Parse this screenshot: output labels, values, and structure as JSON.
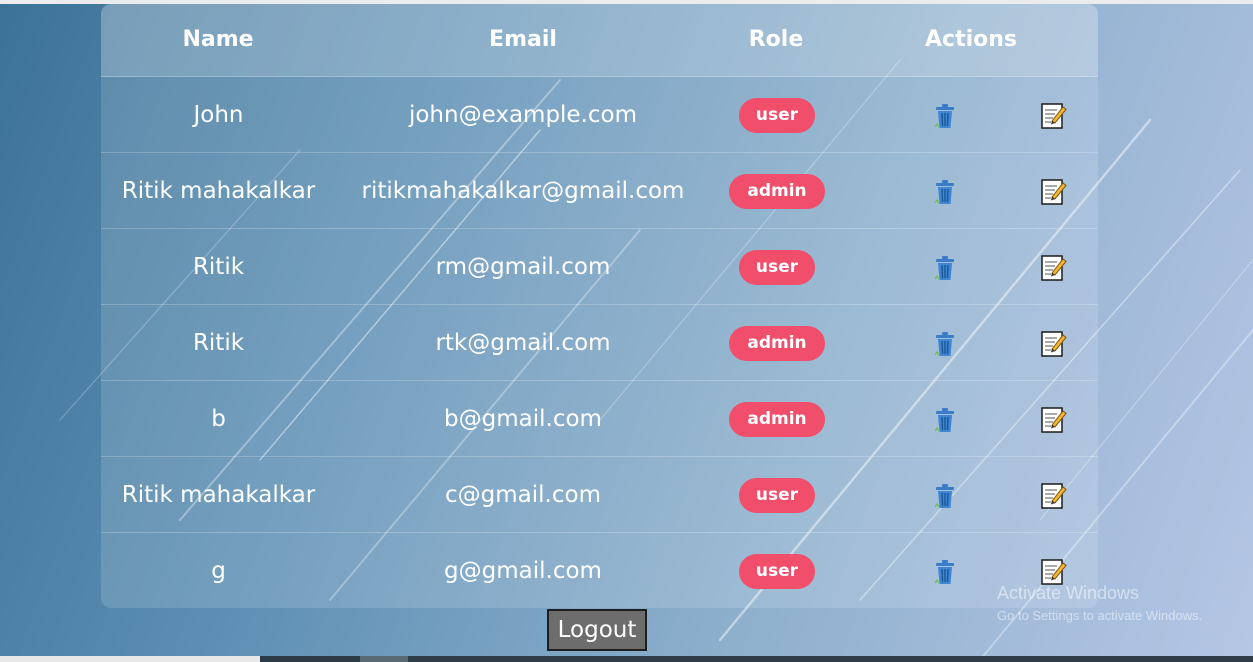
{
  "table": {
    "headers": {
      "name": "Name",
      "email": "Email",
      "role": "Role",
      "actions": "Actions"
    },
    "rows": [
      {
        "name": "John",
        "email": "john@example.com",
        "role": "user"
      },
      {
        "name": "Ritik mahakalkar",
        "email": "ritikmahakalkar@gmail.com",
        "role": "admin"
      },
      {
        "name": "Ritik",
        "email": "rm@gmail.com",
        "role": "user"
      },
      {
        "name": "Ritik",
        "email": "rtk@gmail.com",
        "role": "admin"
      },
      {
        "name": "b",
        "email": "b@gmail.com",
        "role": "admin"
      },
      {
        "name": "Ritik mahakalkar",
        "email": "c@gmail.com",
        "role": "user"
      },
      {
        "name": "g",
        "email": "g@gmail.com",
        "role": "user"
      }
    ],
    "action_icons": [
      "trash-icon",
      "edit-icon"
    ]
  },
  "logout_label": "Logout",
  "watermark": {
    "title": "Activate Windows",
    "subtitle": "Go to Settings to activate Windows."
  },
  "colors": {
    "badge": "#f04e6a",
    "logout_bg": "#6d6d6d"
  }
}
